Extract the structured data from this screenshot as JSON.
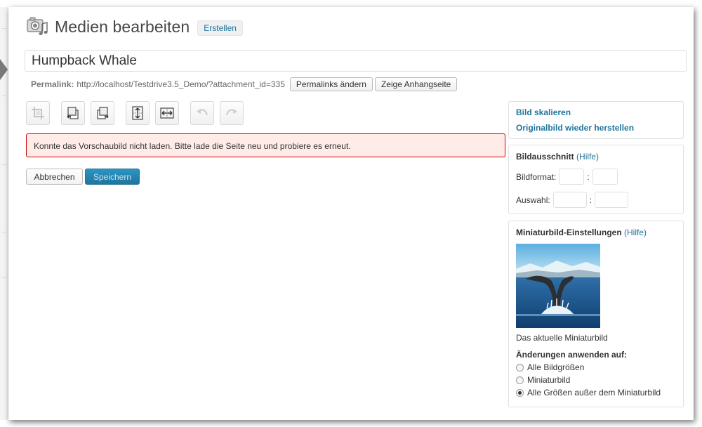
{
  "header": {
    "title": "Medien bearbeiten",
    "create_label": "Erstellen"
  },
  "title_field": {
    "value": "Humpback Whale"
  },
  "permalink": {
    "label": "Permalink:",
    "url": "http://localhost/Testdrive3.5_Demo/?attachment_id=335",
    "change_label": "Permalinks ändern",
    "view_label": "Zeige Anhangseite"
  },
  "toolbar": {
    "icons": [
      "crop-icon",
      "rotate-counterclockwise-icon",
      "rotate-clockwise-icon",
      "flip-vertical-icon",
      "flip-horizontal-icon",
      "undo-icon",
      "redo-icon"
    ]
  },
  "error": {
    "message": "Konnte das Vorschaubild nicht laden. Bitte lade die Seite neu und probiere es erneut."
  },
  "actions": {
    "cancel_label": "Abbrechen",
    "save_label": "Speichern"
  },
  "scale_box": {
    "scale_label": "Bild skalieren",
    "restore_label": "Originalbild wieder herstellen"
  },
  "crop_box": {
    "heading": "Bildausschnitt",
    "help": "(Hilfe)",
    "ratio_label": "Bildformat:",
    "selection_label": "Auswahl:",
    "separator": ":"
  },
  "thumb_box": {
    "heading": "Miniaturbild-Einstellungen",
    "help": "(Hilfe)",
    "caption": "Das aktuelle Miniaturbild",
    "apply_heading": "Änderungen anwenden auf:",
    "options": [
      {
        "label": "Alle Bildgrößen",
        "checked": false
      },
      {
        "label": "Miniaturbild",
        "checked": false
      },
      {
        "label": "Alle Größen außer dem Miniaturbild",
        "checked": true
      }
    ]
  },
  "colors": {
    "link": "#21759b",
    "error_bg": "#ffebe8",
    "error_border": "#cc0000",
    "primary": "#21759b"
  }
}
